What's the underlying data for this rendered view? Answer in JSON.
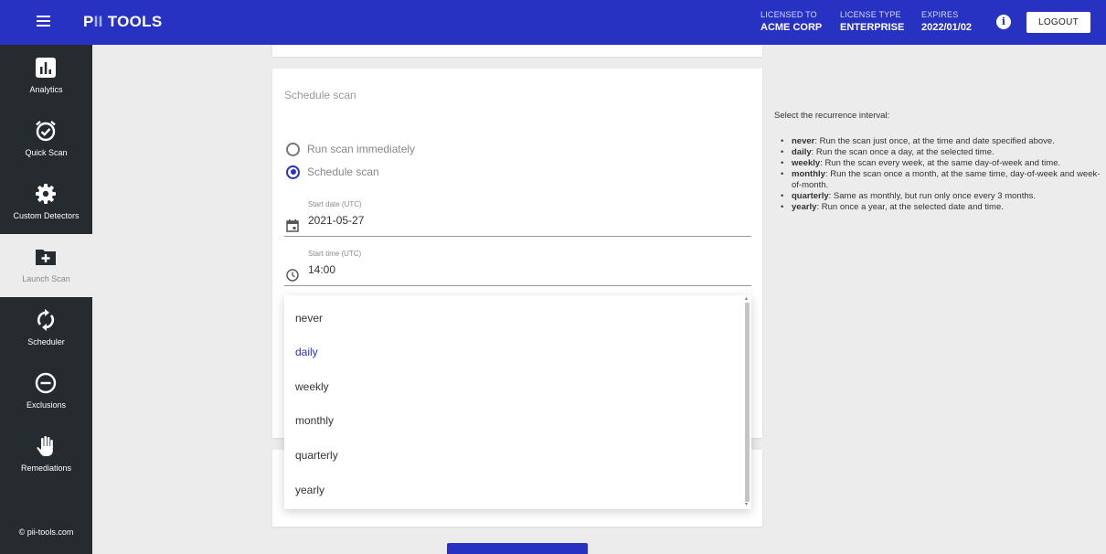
{
  "header": {
    "logo_prefix": "P",
    "logo_ii": "II",
    "logo_suffix": " TOOLS",
    "licensed_to_label": "LICENSED TO",
    "licensed_to_value": "ACME CORP",
    "license_type_label": "LICENSE TYPE",
    "license_type_value": "ENTERPRISE",
    "expires_label": "EXPIRES",
    "expires_value": "2022/01/02",
    "logout_label": "LOGOUT",
    "info_icon_glyph": "i"
  },
  "sidebar": {
    "items": [
      {
        "label": "Analytics",
        "icon": "bar-chart-icon"
      },
      {
        "label": "Quick Scan",
        "icon": "alarm-check-icon"
      },
      {
        "label": "Custom Detectors",
        "icon": "gear-icon"
      },
      {
        "label": "Launch Scan",
        "icon": "folder-plus-icon",
        "active": true
      },
      {
        "label": "Scheduler",
        "icon": "sync-icon"
      },
      {
        "label": "Exclusions",
        "icon": "minus-circle-icon"
      },
      {
        "label": "Remediations",
        "icon": "hand-icon"
      }
    ],
    "copyright": "© pii-tools.com"
  },
  "schedule": {
    "title": "Schedule scan",
    "radio_immediate": "Run scan immediately",
    "radio_schedule": "Schedule scan",
    "start_date_label": "Start date (UTC)",
    "start_date_value": "2021-05-27",
    "start_time_label": "Start time (UTC)",
    "start_time_value": "14:00"
  },
  "recurrence_options": [
    "never",
    "daily",
    "weekly",
    "monthly",
    "quarterly",
    "yearly"
  ],
  "recurrence_selected": "daily",
  "help": {
    "intro": "Select the recurrence interval:",
    "items": [
      {
        "term": "never",
        "text": ": Run the scan just once, at the time and date specified above."
      },
      {
        "term": "daily",
        "text": ": Run the scan once a day, at the selected time."
      },
      {
        "term": "weekly",
        "text": ": Run the scan every week, at the same day-of-week and time."
      },
      {
        "term": "monthly",
        "text": ": Run the scan once a month, at the same time, day-of-week and week-of-month."
      },
      {
        "term": "quarterly",
        "text": ": Same as monthly, but run only once every 3 months."
      },
      {
        "term": "yearly",
        "text": ": Run once a year, at the selected date and time."
      }
    ]
  },
  "colors": {
    "brand": "#2832c2",
    "sidebar_bg": "#262b2f",
    "page_bg": "#ececec"
  }
}
